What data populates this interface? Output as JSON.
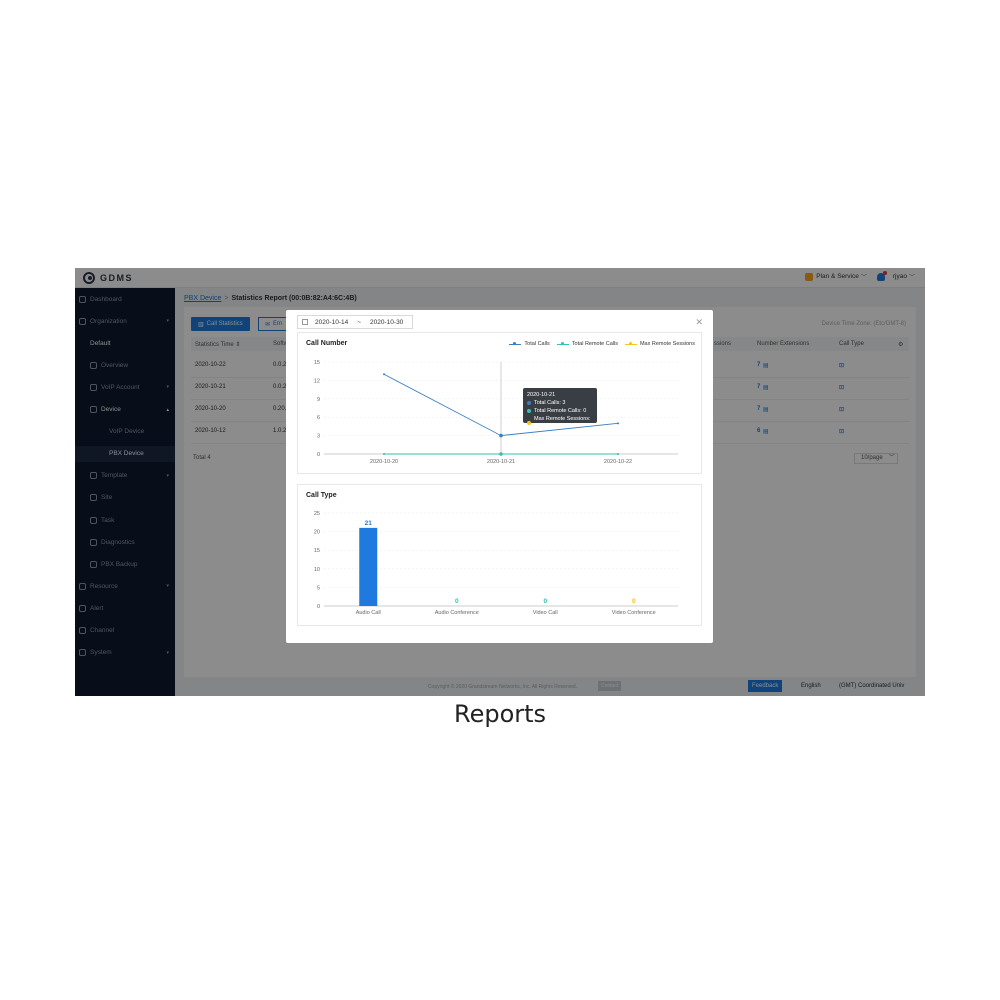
{
  "caption": "Reports",
  "app": {
    "logo_text": "GDMS",
    "plan_label": "Plan & Service",
    "user": "rjyao"
  },
  "sidebar": {
    "items": [
      {
        "label": "Dashboard",
        "level": 0,
        "icon": "dashboard-icon"
      },
      {
        "label": "Organization",
        "level": 0,
        "icon": "org-icon",
        "caret": "▾"
      },
      {
        "label": "Default",
        "level": 1,
        "white": true
      },
      {
        "label": "Overview",
        "level": 1,
        "icon": "chart-icon"
      },
      {
        "label": "VoIP Account",
        "level": 1,
        "icon": "user-icon",
        "caret": "▾"
      },
      {
        "label": "Device",
        "level": 1,
        "icon": "device-icon",
        "caret": "▴",
        "white": true
      },
      {
        "label": "VoIP Device",
        "level": 2
      },
      {
        "label": "PBX Device",
        "level": 2,
        "active": true
      },
      {
        "label": "Template",
        "level": 1,
        "icon": "template-icon",
        "caret": "▾"
      },
      {
        "label": "Site",
        "level": 1,
        "icon": "site-icon"
      },
      {
        "label": "Task",
        "level": 1,
        "icon": "task-icon"
      },
      {
        "label": "Diagnostics",
        "level": 1,
        "icon": "diagnostics-icon"
      },
      {
        "label": "PBX Backup",
        "level": 1,
        "icon": "backup-icon"
      },
      {
        "label": "Resource",
        "level": 0,
        "icon": "resource-icon",
        "caret": "▾"
      },
      {
        "label": "Alert",
        "level": 0,
        "icon": "alert-icon"
      },
      {
        "label": "Channel",
        "level": 0,
        "icon": "channel-icon"
      },
      {
        "label": "System",
        "level": 0,
        "icon": "system-icon",
        "caret": "▾"
      }
    ]
  },
  "breadcrumb": {
    "parent": "PBX Device",
    "sep": ">",
    "current": "Statistics Report (00:0B:82:A4:6C:4B)"
  },
  "toolbar": {
    "call_stats_label": "Call Statistics",
    "email_label": "Em",
    "timezone_label": "Device Time Zone: (Etc/GMT-8)"
  },
  "table": {
    "headers": {
      "time": "Statistics Time ⇕",
      "software": "Softw",
      "sessions": "ssions",
      "extensions": "Number Extensions",
      "call_type": "Call Type"
    },
    "rows": [
      {
        "time": "2020-10-22",
        "software": "0.0.2",
        "extensions": "7"
      },
      {
        "time": "2020-10-21",
        "software": "0.0.2",
        "extensions": "7"
      },
      {
        "time": "2020-10-20",
        "software": "0.20.",
        "extensions": "7"
      },
      {
        "time": "2020-10-12",
        "software": "1.0.2",
        "extensions": "6"
      }
    ],
    "total": "Total 4",
    "page_size": "10/page"
  },
  "footer": {
    "copyright": "Copyright © 2020 Grandstream Networks, Inc. All Rights Reserved.",
    "contact": "Contact",
    "feedback": "Feedback",
    "language": "English",
    "timezone": "(GMT) Coordinated Univ"
  },
  "modal": {
    "date_start": "2020-10-14",
    "date_sep": "~",
    "date_end": "2020-10-30",
    "tooltip": {
      "date": "2020-10-21",
      "lines": [
        "Total Calls: 3",
        "Total Remote Calls: 0",
        "Max Remote Sessions: 0"
      ]
    }
  },
  "colors": {
    "blue": "#1f7ae0",
    "line_blue": "#3a7fc4",
    "teal": "#2fc4b2",
    "yellow": "#f5c518"
  },
  "chart_data": [
    {
      "type": "line",
      "title": "Call Number",
      "x": [
        "2020-10-20",
        "2020-10-21",
        "2020-10-22"
      ],
      "series": [
        {
          "name": "Total Calls",
          "values": [
            13,
            3,
            5
          ]
        },
        {
          "name": "Total Remote Calls",
          "values": [
            0,
            0,
            0
          ]
        },
        {
          "name": "Max Remote Sessions",
          "values": [
            0,
            0,
            0
          ]
        }
      ],
      "yticks": [
        "15",
        "12",
        "9",
        "6",
        "3",
        "0"
      ],
      "ylim": [
        0,
        15
      ],
      "grid": true,
      "legend": "top-right"
    },
    {
      "type": "bar",
      "title": "Call Type",
      "categories": [
        "Audio Call",
        "Audio Conference",
        "Video Call",
        "Video Conference"
      ],
      "values": [
        21,
        0,
        0,
        0
      ],
      "labels": [
        "21",
        "0",
        "0",
        "0"
      ],
      "yticks": [
        "25",
        "20",
        "15",
        "10",
        "5",
        "0"
      ],
      "ylim": [
        0,
        25
      ],
      "grid": true
    }
  ]
}
